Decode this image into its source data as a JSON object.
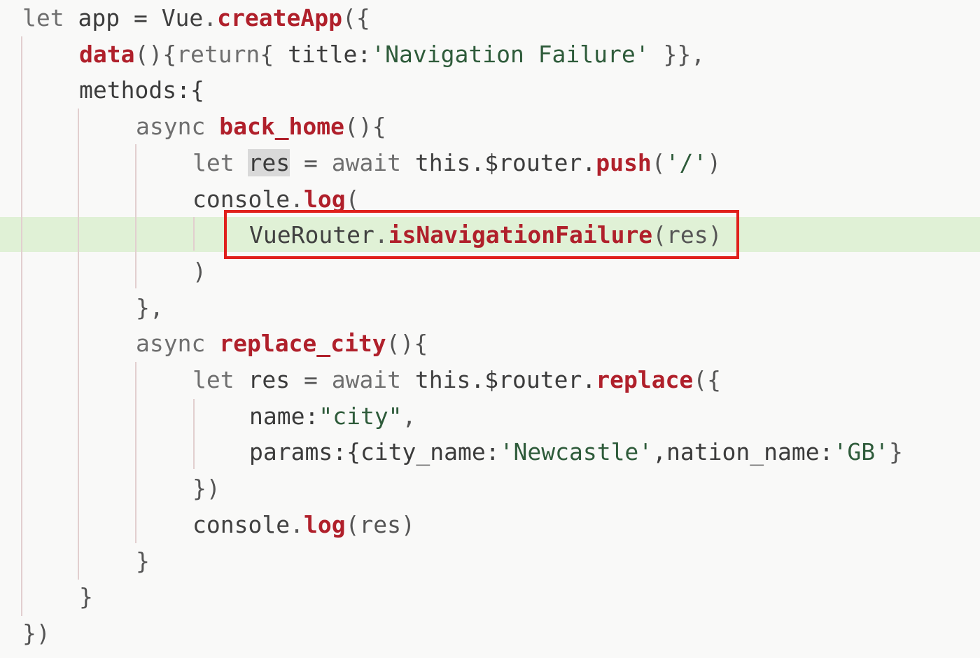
{
  "code": {
    "lines": [
      {
        "indent": 0,
        "tokens": [
          {
            "t": "let",
            "c": "kw"
          },
          {
            "t": " app = ",
            "c": "prop"
          },
          {
            "t": "Vue",
            "c": "obj"
          },
          {
            "t": ".",
            "c": "punct"
          },
          {
            "t": "createApp",
            "c": "fn"
          },
          {
            "t": "({",
            "c": "punct"
          }
        ]
      },
      {
        "indent": 1,
        "tokens": [
          {
            "t": "data",
            "c": "fn"
          },
          {
            "t": "(){",
            "c": "punct"
          },
          {
            "t": "return",
            "c": "kw"
          },
          {
            "t": "{ ",
            "c": "punct"
          },
          {
            "t": "title:",
            "c": "prop"
          },
          {
            "t": "'Navigation Failure'",
            "c": "str"
          },
          {
            "t": " }},",
            "c": "punct"
          }
        ]
      },
      {
        "indent": 1,
        "tokens": [
          {
            "t": "methods:{",
            "c": "prop"
          }
        ]
      },
      {
        "indent": 2,
        "tokens": [
          {
            "t": "async ",
            "c": "kw"
          },
          {
            "t": "back_home",
            "c": "fn"
          },
          {
            "t": "(){",
            "c": "punct"
          }
        ]
      },
      {
        "indent": 3,
        "tokens": [
          {
            "t": "let ",
            "c": "kw"
          },
          {
            "t": "res",
            "c": "prop",
            "sel": true
          },
          {
            "t": " = ",
            "c": "punct"
          },
          {
            "t": "await ",
            "c": "kw"
          },
          {
            "t": "this",
            "c": "obj"
          },
          {
            "t": ".$router.",
            "c": "prop"
          },
          {
            "t": "push",
            "c": "fn"
          },
          {
            "t": "(",
            "c": "punct"
          },
          {
            "t": "'/'",
            "c": "str"
          },
          {
            "t": ")",
            "c": "punct"
          }
        ]
      },
      {
        "indent": 3,
        "tokens": [
          {
            "t": "console",
            "c": "obj"
          },
          {
            "t": ".",
            "c": "punct"
          },
          {
            "t": "log",
            "c": "fn"
          },
          {
            "t": "(",
            "c": "punct"
          }
        ]
      },
      {
        "indent": 4,
        "tokens": [
          {
            "t": "VueRouter",
            "c": "obj"
          },
          {
            "t": ".",
            "c": "punct"
          },
          {
            "t": "isNavigationFailure",
            "c": "fn"
          },
          {
            "t": "(res)",
            "c": "punct"
          }
        ]
      },
      {
        "indent": 3,
        "tokens": [
          {
            "t": ")",
            "c": "punct"
          }
        ]
      },
      {
        "indent": 2,
        "tokens": [
          {
            "t": "},",
            "c": "punct"
          }
        ]
      },
      {
        "indent": 2,
        "tokens": [
          {
            "t": "async ",
            "c": "kw"
          },
          {
            "t": "replace_city",
            "c": "fn"
          },
          {
            "t": "(){",
            "c": "punct"
          }
        ]
      },
      {
        "indent": 3,
        "tokens": [
          {
            "t": "let ",
            "c": "kw"
          },
          {
            "t": "res",
            "c": "prop"
          },
          {
            "t": " = ",
            "c": "punct"
          },
          {
            "t": "await ",
            "c": "kw"
          },
          {
            "t": "this",
            "c": "obj"
          },
          {
            "t": ".$router.",
            "c": "prop"
          },
          {
            "t": "replace",
            "c": "fn"
          },
          {
            "t": "({",
            "c": "punct"
          }
        ]
      },
      {
        "indent": 4,
        "tokens": [
          {
            "t": "name:",
            "c": "prop"
          },
          {
            "t": "\"city\"",
            "c": "str"
          },
          {
            "t": ",",
            "c": "punct"
          }
        ]
      },
      {
        "indent": 4,
        "tokens": [
          {
            "t": "params:{city_name:",
            "c": "prop"
          },
          {
            "t": "'Newcastle'",
            "c": "str"
          },
          {
            "t": ",nation_name:",
            "c": "prop"
          },
          {
            "t": "'GB'",
            "c": "str"
          },
          {
            "t": "}",
            "c": "punct"
          }
        ]
      },
      {
        "indent": 3,
        "tokens": [
          {
            "t": "})",
            "c": "punct"
          }
        ]
      },
      {
        "indent": 3,
        "tokens": [
          {
            "t": "console",
            "c": "obj"
          },
          {
            "t": ".",
            "c": "punct"
          },
          {
            "t": "log",
            "c": "fn"
          },
          {
            "t": "(res)",
            "c": "punct"
          }
        ]
      },
      {
        "indent": 2,
        "tokens": [
          {
            "t": "}",
            "c": "punct"
          }
        ]
      },
      {
        "indent": 1,
        "tokens": [
          {
            "t": "}",
            "c": "punct"
          }
        ]
      },
      {
        "indent": 0,
        "tokens": [
          {
            "t": "})",
            "c": "punct"
          }
        ]
      }
    ]
  },
  "annotation": {
    "target_line": 7,
    "color": "#e0201c"
  },
  "colors": {
    "background": "#f9f9f8",
    "highlight_line": "#e0f1d6",
    "keyword": "#6f6f6f",
    "function": "#b0202b",
    "string": "#2e5b3a",
    "guide": "#e2cfcf"
  }
}
